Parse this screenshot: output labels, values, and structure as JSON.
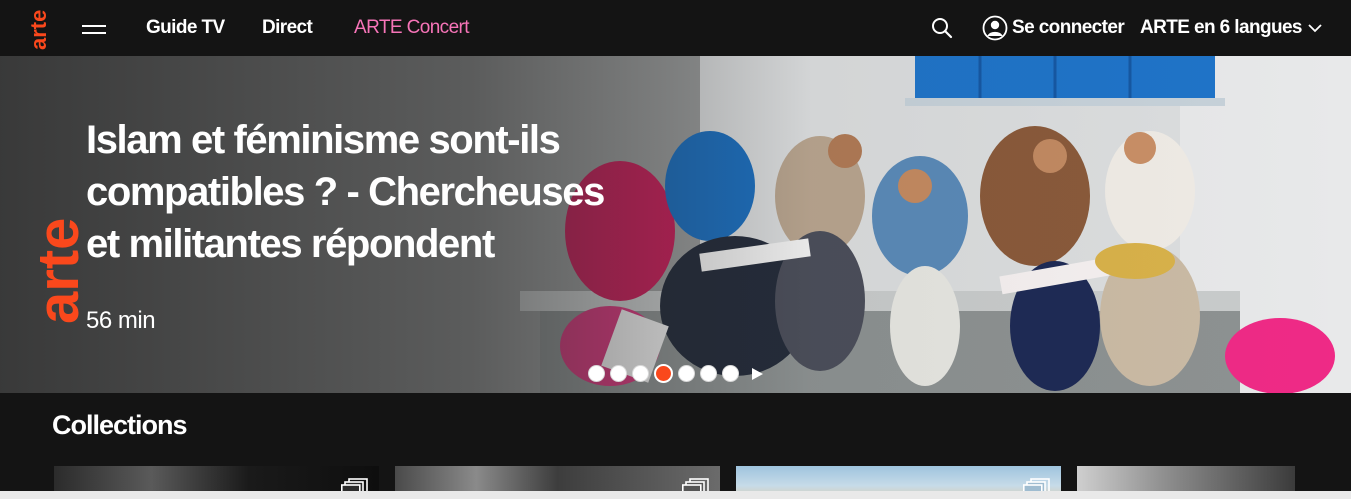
{
  "header": {
    "logo_text": "arte",
    "nav": [
      {
        "label": "Guide TV"
      },
      {
        "label": "Direct"
      },
      {
        "label": "ARTE Concert"
      }
    ],
    "account_label": "Se connecter",
    "language_label": "ARTE en 6 langues",
    "colors": {
      "accent": "#fa481c",
      "concert": "#f774b8",
      "background": "#141414"
    }
  },
  "hero": {
    "logo_text": "arte",
    "title": "Islam et féminisme sont-ils compatibles ? - Chercheuses et militantes répondent",
    "duration": "56 min",
    "carousel": {
      "total": 7,
      "active": 4
    }
  },
  "collections": {
    "title": "Collections",
    "cards": [
      {
        "icon": "stack-icon"
      },
      {
        "icon": "stack-icon"
      },
      {
        "icon": "stack-icon"
      },
      {
        "icon": "stack-icon"
      }
    ]
  }
}
